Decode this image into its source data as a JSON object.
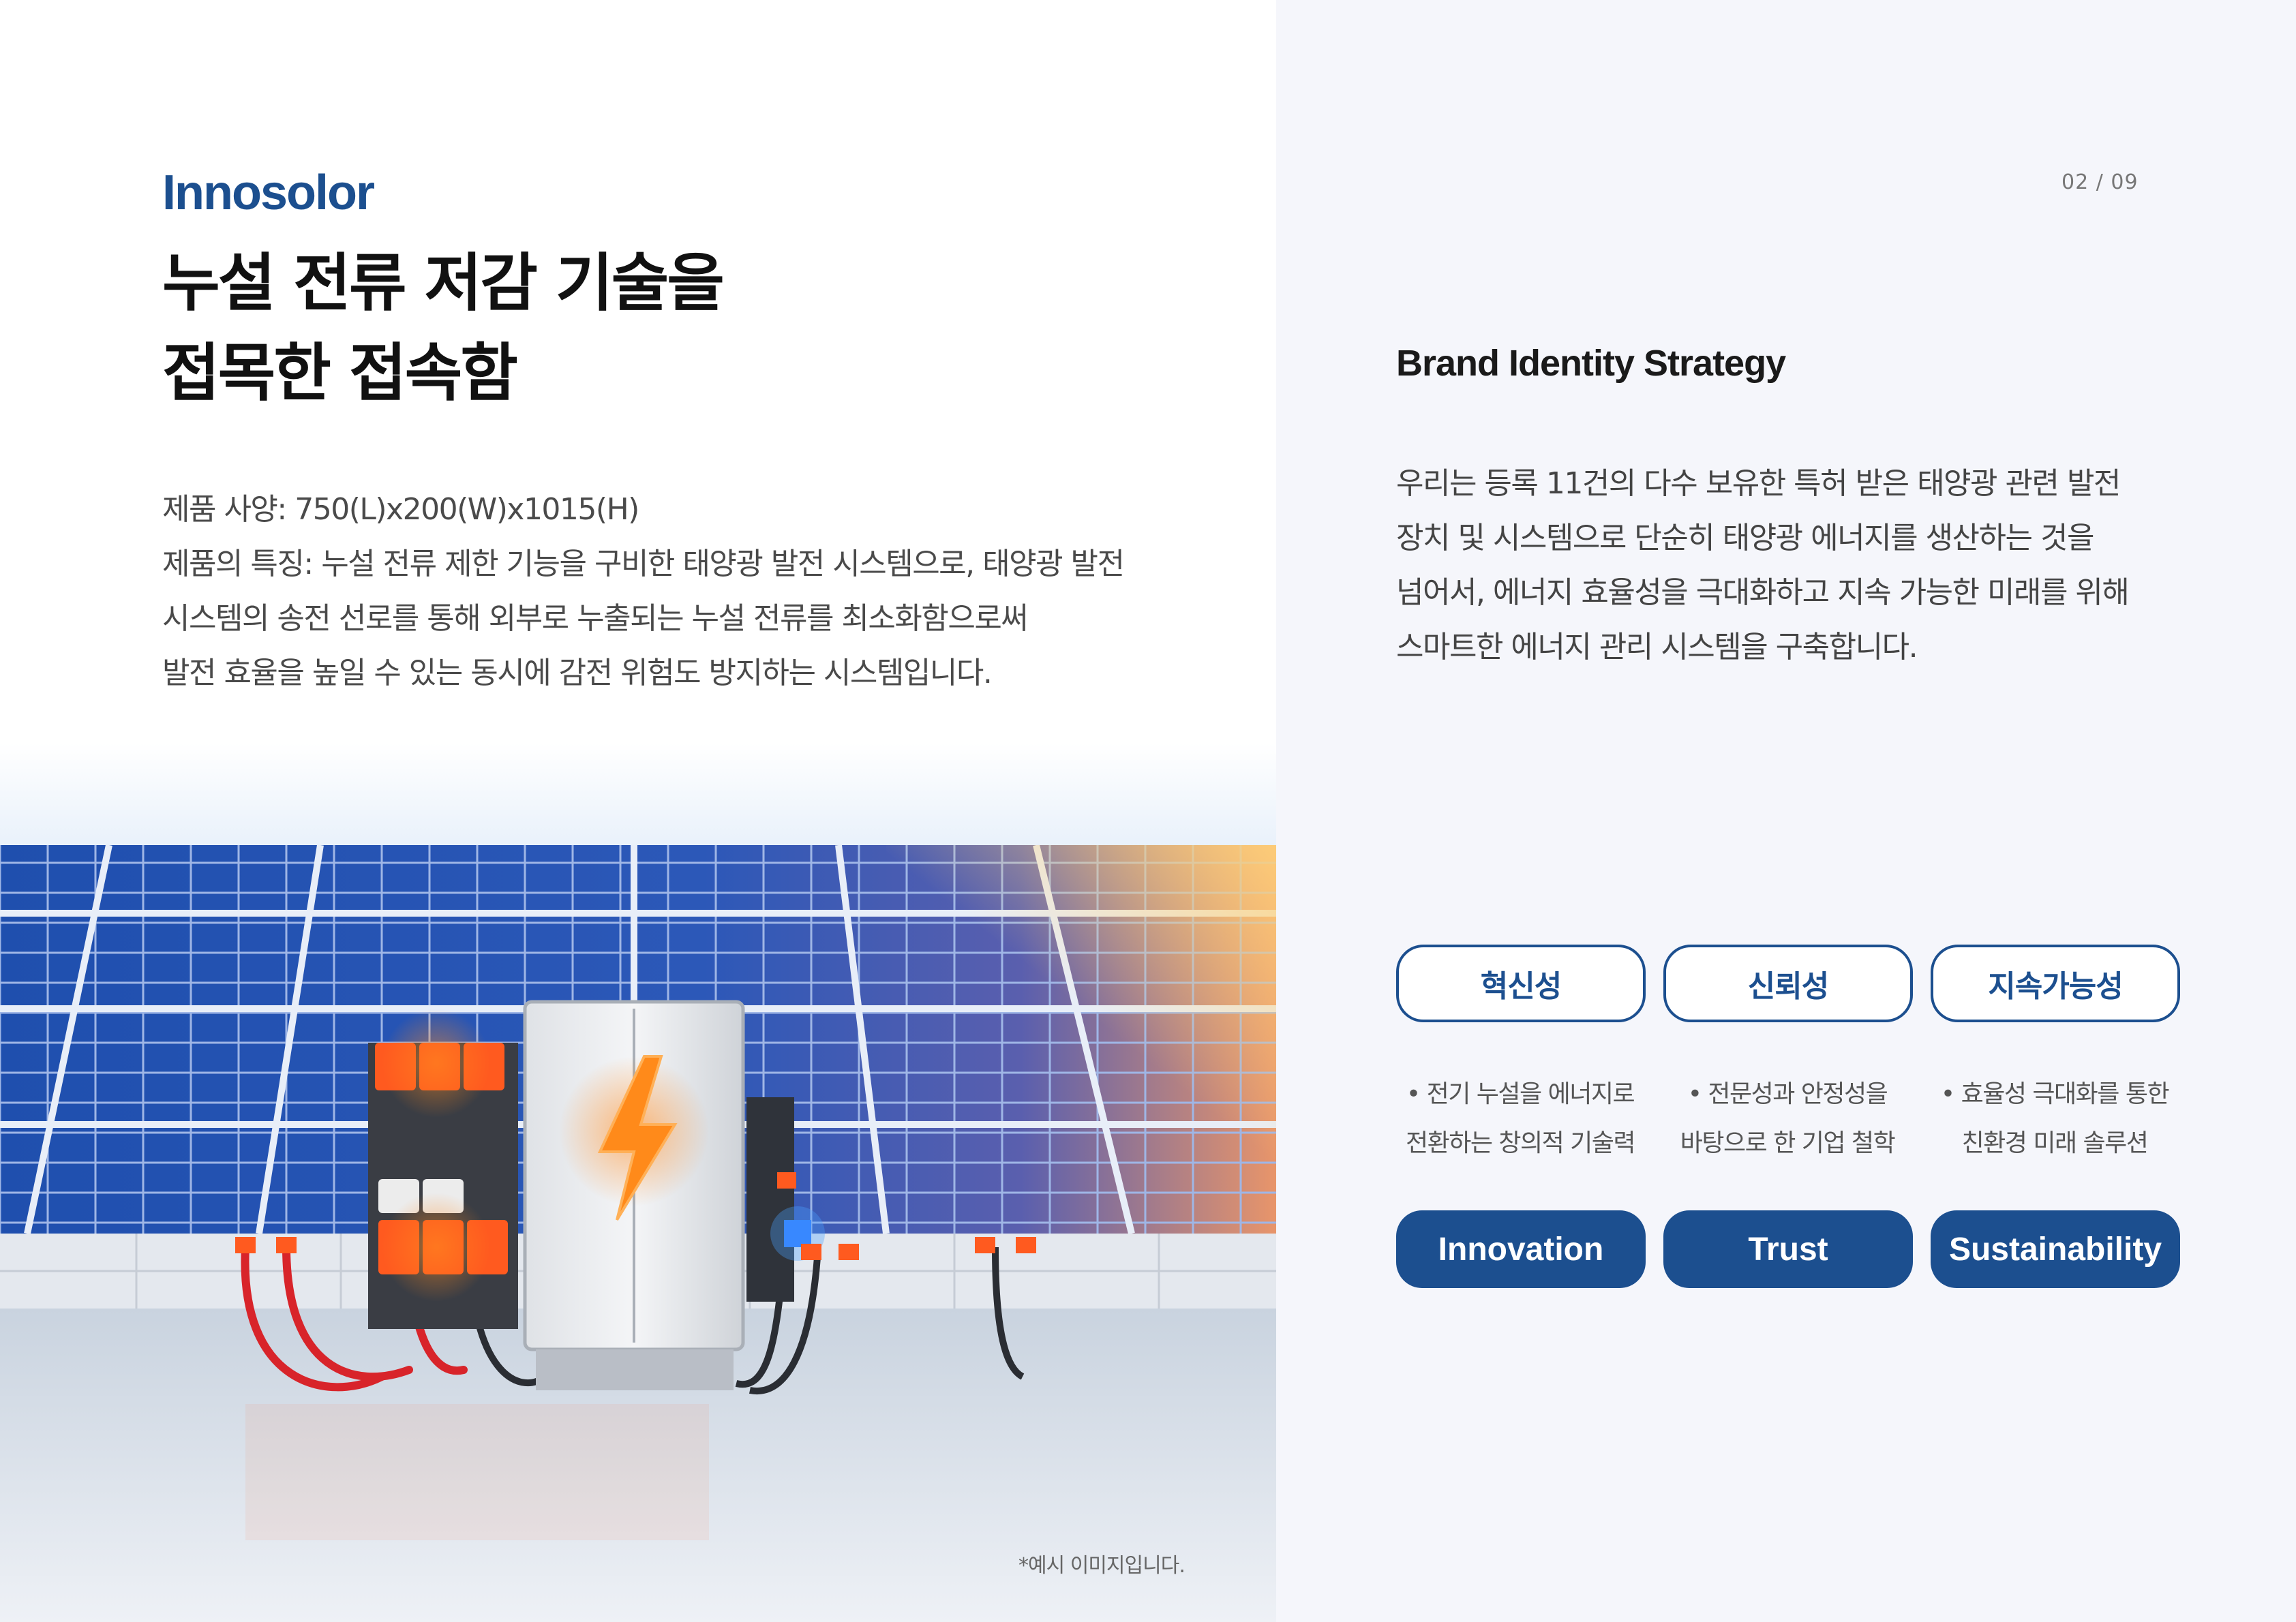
{
  "left": {
    "brand": "Innosolor",
    "title_line1": "누설 전류 저감 기술을",
    "title_line2": "접목한 접속함",
    "desc_lines": [
      "제품 사양: 750(L)x200(W)x1015(H)",
      "제품의 특징: 누설 전류 제한 기능을 구비한 태양광 발전 시스템으로, 태양광 발전",
      "시스템의 송전 선로를 통해 외부로 누출되는 누설 전류를 최소화함으로써",
      "발전 효율을 높일 수 있는 동시에 감전 위험도 방지하는 시스템입니다."
    ],
    "caption": "*예시 이미지입니다."
  },
  "right": {
    "page_number": "02 / 09",
    "title": "Brand Identity Strategy",
    "desc_lines": [
      "우리는 등록 11건의 다수 보유한 특허 받은 태양광 관련 발전",
      "장치 및 시스템으로 단순히 태양광 에너지를 생산하는 것을",
      "넘어서, 에너지 효율성을 극대화하고 지속 가능한 미래를 위해",
      "스마트한 에너지 관리 시스템을 구축합니다."
    ],
    "values": [
      {
        "ko": "혁신성",
        "bullet_line1": "• 전기 누설을 에너지로",
        "bullet_line2": "전환하는 창의적 기술력",
        "en": "Innovation"
      },
      {
        "ko": "신뢰성",
        "bullet_line1": "• 전문성과 안정성을",
        "bullet_line2": "바탕으로 한 기업 철학",
        "en": "Trust"
      },
      {
        "ko": "지속가능성",
        "bullet_line1": "• 효율성 극대화를 통한",
        "bullet_line2": "친환경 미래 솔루션",
        "en": "Sustainability"
      }
    ]
  },
  "colors": {
    "brand_blue": "#1c4f8f",
    "right_panel_bg": "#f5f6fb",
    "text_dark": "#111111",
    "text_gray": "#4a4a4a"
  },
  "icons": [
    "lightning-bolt-icon"
  ]
}
